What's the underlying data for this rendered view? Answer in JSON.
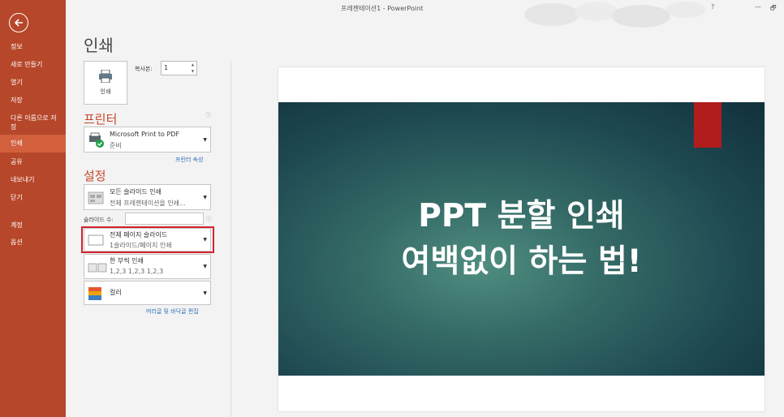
{
  "window": {
    "title": "프레젠테이션1 - PowerPoint",
    "help": "?",
    "minimize": "—",
    "restore": "🗗"
  },
  "sidebar": {
    "items": [
      {
        "label": "정보"
      },
      {
        "label": "새로 만들기"
      },
      {
        "label": "열기"
      },
      {
        "label": "저장"
      },
      {
        "label": "다른 이름으로 저"
      },
      {
        "label": "장"
      },
      {
        "label": "인쇄"
      },
      {
        "label": "공유"
      },
      {
        "label": "내보내기"
      },
      {
        "label": "닫기"
      },
      {
        "label": "계정"
      },
      {
        "label": "옵션"
      }
    ]
  },
  "print": {
    "title": "인쇄",
    "button_label": "인쇄",
    "copies_label": "복사본:",
    "copies_value": "1"
  },
  "printer": {
    "section_title": "프린터",
    "name": "Microsoft Print to PDF",
    "status": "준비",
    "properties_link": "프린터 속성"
  },
  "settings": {
    "section_title": "설정",
    "range_main": "모든 슬라이드 인쇄",
    "range_sub": "전체 프레젠테이션을 인쇄...",
    "slides_label": "슬라이드 수:",
    "slides_value": "",
    "layout_main": "전체 페이지 슬라이드",
    "layout_sub": "1슬라이드/페이지 인쇄",
    "collate_main": "한 부씩 인쇄",
    "collate_sub": "1,2,3    1,2,3    1,2,3",
    "color_main": "컬러",
    "header_footer_link": "머리글 및 바닥글 편집"
  },
  "slide": {
    "line1": "PPT 분할 인쇄",
    "line2": "여백없이 하는 법!"
  },
  "colors": {
    "sidebar": "#b7472a",
    "sidebar_active": "#d2603d",
    "accent_text": "#c4462a",
    "highlight": "#d3232f",
    "slide_accent": "#b11c1c"
  }
}
